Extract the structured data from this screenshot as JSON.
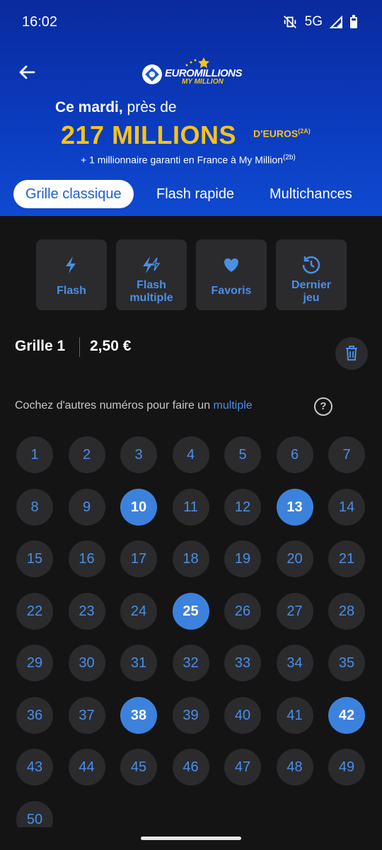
{
  "status_bar": {
    "time": "16:02",
    "network": "5G"
  },
  "header": {
    "logo_line1": "EUROMILLIONS",
    "logo_line2": "MY MILLION",
    "line1_bold": "Ce mardi,",
    "line1_rest": " près de",
    "jackpot": "217 MILLIONS",
    "jackpot_suffix": "D'EUROS",
    "jackpot_sup": "(2A)",
    "subline": "+ 1 millionnaire garanti en France à My Million",
    "subline_sup": "(2b)"
  },
  "tabs": [
    {
      "label": "Grille classique",
      "active": true
    },
    {
      "label": "Flash rapide",
      "active": false
    },
    {
      "label": "Multichances",
      "active": false
    }
  ],
  "actions": [
    {
      "label1": "Flash",
      "label2": "",
      "icon": "lightning-icon"
    },
    {
      "label1": "Flash",
      "label2": "multiple",
      "icon": "double-lightning-icon"
    },
    {
      "label1": "Favoris",
      "label2": "",
      "icon": "heart-icon"
    },
    {
      "label1": "Dernier",
      "label2": "jeu",
      "icon": "history-icon"
    }
  ],
  "grid": {
    "title": "Grille 1",
    "price": "2,50 €"
  },
  "hint": {
    "text": "Cochez d'autres numéros pour faire un ",
    "link": "multiple",
    "help": "?"
  },
  "numbers": {
    "values": [
      "1",
      "2",
      "3",
      "4",
      "5",
      "6",
      "7",
      "8",
      "9",
      "10",
      "11",
      "12",
      "13",
      "14",
      "15",
      "16",
      "17",
      "18",
      "19",
      "20",
      "21",
      "22",
      "23",
      "24",
      "25",
      "26",
      "27",
      "28",
      "29",
      "30",
      "31",
      "32",
      "33",
      "34",
      "35",
      "36",
      "37",
      "38",
      "39",
      "40",
      "41",
      "42",
      "43",
      "44",
      "45",
      "46",
      "47",
      "48",
      "49",
      "50"
    ],
    "selected": [
      "10",
      "13",
      "25",
      "38",
      "42"
    ]
  },
  "colors": {
    "accent": "#3c82dc",
    "jackpot": "#f7c21a",
    "header_blue": "#0b3cc0"
  }
}
